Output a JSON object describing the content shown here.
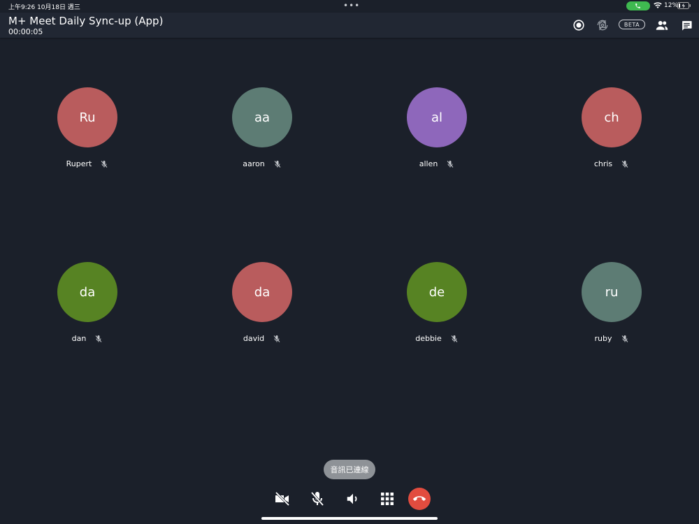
{
  "status_bar": {
    "time": "上午9:26  10月18日 週三",
    "battery_percent": "12%",
    "icons": [
      "multitask-dots-icon",
      "phone-icon",
      "wifi-icon",
      "battery-charging-icon"
    ]
  },
  "header": {
    "title": "M+ Meet Daily Sync-up (App)",
    "timer": "00:00:05",
    "beta_label": "BETA",
    "icons": [
      "record-icon",
      "switch-camera-icon",
      "participants-icon",
      "chat-icon"
    ]
  },
  "participants": [
    {
      "initials": "Ru",
      "name": "Rupert",
      "color": "#b95c5d"
    },
    {
      "initials": "aa",
      "name": "aaron",
      "color": "#5d7c74"
    },
    {
      "initials": "al",
      "name": "allen",
      "color": "#8e67bb"
    },
    {
      "initials": "ch",
      "name": "chris",
      "color": "#b95c5d"
    },
    {
      "initials": "da",
      "name": "dan",
      "color": "#578323"
    },
    {
      "initials": "da",
      "name": "david",
      "color": "#b95c5d"
    },
    {
      "initials": "de",
      "name": "debbie",
      "color": "#578323"
    },
    {
      "initials": "ru",
      "name": "ruby",
      "color": "#5d7c74"
    }
  ],
  "toast": "音訊已連線",
  "controls": {
    "icons": [
      "video-off-icon",
      "mic-off-icon",
      "speaker-icon",
      "keypad-icon",
      "hang-up-icon"
    ],
    "hangup_color": "#e24c3f"
  },
  "colors": {
    "background": "#1b202a",
    "header": "#212733"
  }
}
